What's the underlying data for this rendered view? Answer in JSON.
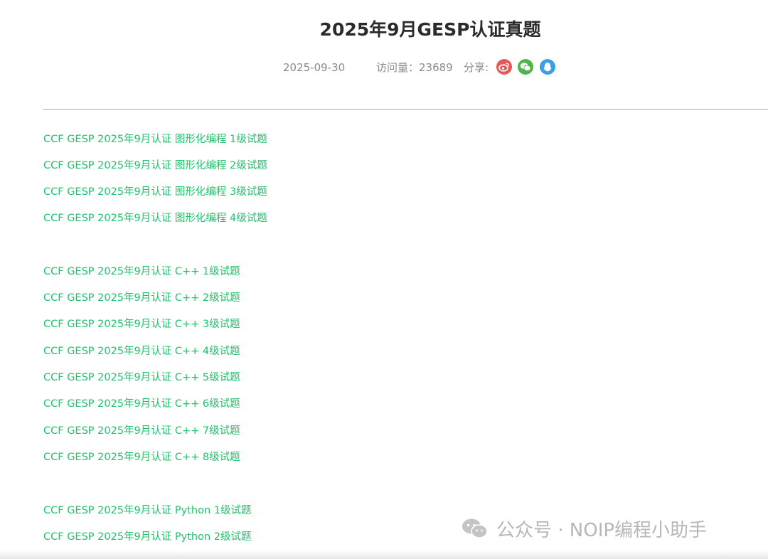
{
  "article": {
    "title": "2025年9月GESP认证真题",
    "date": "2025-09-30",
    "views_label": "访问量：23689",
    "share_label": "分享:"
  },
  "share": {
    "weibo_icon": "weibo-icon",
    "wechat_icon": "wechat-icon",
    "qq_icon": "qq-icon",
    "colors": {
      "weibo": "#e25b57",
      "wechat": "#4cb649",
      "qq": "#3c9ee6"
    }
  },
  "links": {
    "graphical": [
      "CCF GESP 2025年9月认证 图形化编程 1级试题",
      "CCF GESP 2025年9月认证 图形化编程 2级试题",
      "CCF GESP 2025年9月认证 图形化编程 3级试题",
      "CCF GESP 2025年9月认证 图形化编程 4级试题"
    ],
    "cpp": [
      "CCF GESP 2025年9月认证 C++ 1级试题",
      "CCF GESP 2025年9月认证 C++ 2级试题",
      "CCF GESP 2025年9月认证 C++ 3级试题",
      "CCF GESP 2025年9月认证 C++ 4级试题",
      "CCF GESP 2025年9月认证 C++ 5级试题",
      "CCF GESP 2025年9月认证 C++ 6级试题",
      "CCF GESP 2025年9月认证 C++ 7级试题",
      "CCF GESP 2025年9月认证 C++ 8级试题"
    ],
    "python": [
      "CCF GESP 2025年9月认证 Python 1级试题",
      "CCF GESP 2025年9月认证 Python 2级试题"
    ]
  },
  "watermark": {
    "text": "公众号 · NOIP编程小助手",
    "icon": "wechat-official-account-icon"
  },
  "colors": {
    "link": "#1ec36a",
    "title": "#2b2b2b",
    "meta": "#8a8a8a"
  }
}
